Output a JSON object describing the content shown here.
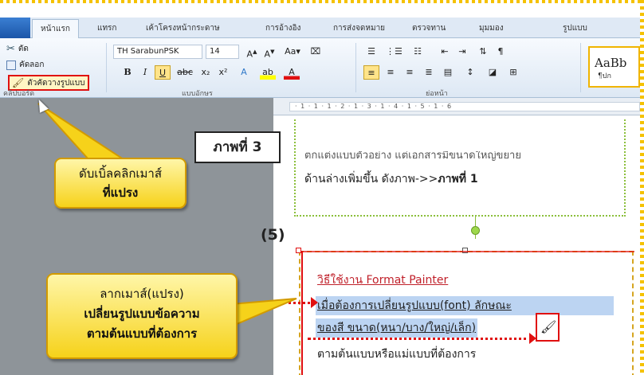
{
  "ribbon_tabs": [
    "หน้าแรก",
    "แทรก",
    "เค้าโครงหน้ากระดาษ",
    "การอ้างอิง",
    "การส่งจดหมาย",
    "ตรวจทาน",
    "มุมมอง",
    "รูปแบบ"
  ],
  "clipboard": {
    "cut_label": "ตัด",
    "copy_label": "คัดลอก",
    "format_painter_label": "ตัวคัดวางรูปแบบ",
    "group_label": "คลิปบอร์ด"
  },
  "font": {
    "name": "TH SarabunPSK",
    "size": "14",
    "group_label": "แบบอักษร"
  },
  "paragraph": {
    "group_label": "ย่อหน้า"
  },
  "styles": {
    "preview_text": "AaBb",
    "preview_caption": "¶ปก"
  },
  "ruler_text": "· 1 · 1 · 1 · 2 · 1 · 3 · 1 · 4 · 1 · 5 · 1 · 6",
  "figure_label": "ภาพที่ 3",
  "callout_1": {
    "line1": "ดับเบิ้ลคลิกเมาส์",
    "line2": "ที่แปรง"
  },
  "callout_2": {
    "line1": "ลากเมาส์(แปรง)",
    "line2": "เปลี่ยนรูปแบบข้อความ",
    "line3": "ตามต้นแบบที่ต้องการ"
  },
  "step_number": "(5)",
  "document": {
    "cut_line": "ตกแต่งแบบตัวอย่าง แต่เอกสารมีขนาดใหญ่ขยาย",
    "line_top": "ด้านล่างเพิ่มขึ้น ดังภาพ->>",
    "line_top_bold": "ภาพที่ 1",
    "heading": "วิธีใช้งาน Format Painter",
    "line1": "เมื่อต้องการเปลี่ยนรูปแบบ(font) ลักษณะ",
    "line2": "ของสี ขนาด(หนา/บาง/ใหญ่/เล็ก)",
    "line3": "ตามต้นแบบหรือแม่แบบที่ต้องการ"
  }
}
